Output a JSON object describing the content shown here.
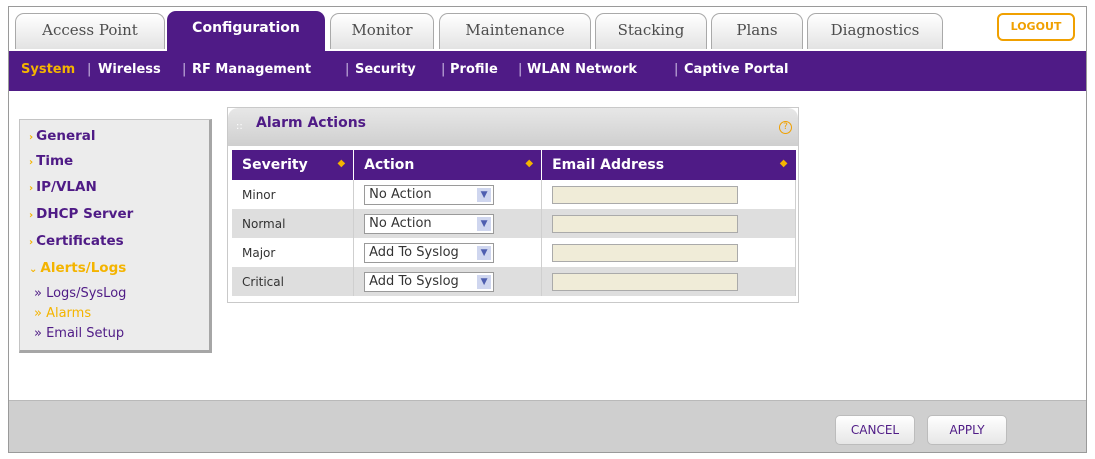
{
  "tabs": [
    {
      "label": "Access Point"
    },
    {
      "label": "Configuration"
    },
    {
      "label": "Monitor"
    },
    {
      "label": "Maintenance"
    },
    {
      "label": "Stacking"
    },
    {
      "label": "Plans"
    },
    {
      "label": "Diagnostics"
    }
  ],
  "logout_label": "LOGOUT",
  "subnav": [
    {
      "label": "System"
    },
    {
      "label": "Wireless"
    },
    {
      "label": "RF Management"
    },
    {
      "label": "Security"
    },
    {
      "label": "Profile"
    },
    {
      "label": "WLAN Network"
    },
    {
      "label": "Captive Portal"
    }
  ],
  "sidebar": {
    "items": [
      {
        "label": "General"
      },
      {
        "label": "Time"
      },
      {
        "label": "IP/VLAN"
      },
      {
        "label": "DHCP Server"
      },
      {
        "label": "Certificates"
      },
      {
        "label": "Alerts/Logs"
      }
    ],
    "subitems": [
      {
        "label": "» Logs/SysLog"
      },
      {
        "label": "» Alarms"
      },
      {
        "label": "» Email Setup"
      }
    ]
  },
  "panel": {
    "title": "Alarm Actions",
    "help": "?",
    "columns": [
      "Severity",
      "Action",
      "Email Address"
    ],
    "rows": [
      {
        "severity": "Minor",
        "action": "No Action",
        "email": ""
      },
      {
        "severity": "Normal",
        "action": "No Action",
        "email": ""
      },
      {
        "severity": "Major",
        "action": "Add To Syslog",
        "email": ""
      },
      {
        "severity": "Critical",
        "action": "Add To Syslog",
        "email": ""
      }
    ]
  },
  "footer": {
    "cancel_label": "CANCEL",
    "apply_label": "APPLY"
  },
  "colors": {
    "brand_purple": "#4f1b86",
    "accent_orange": "#f4b400"
  }
}
